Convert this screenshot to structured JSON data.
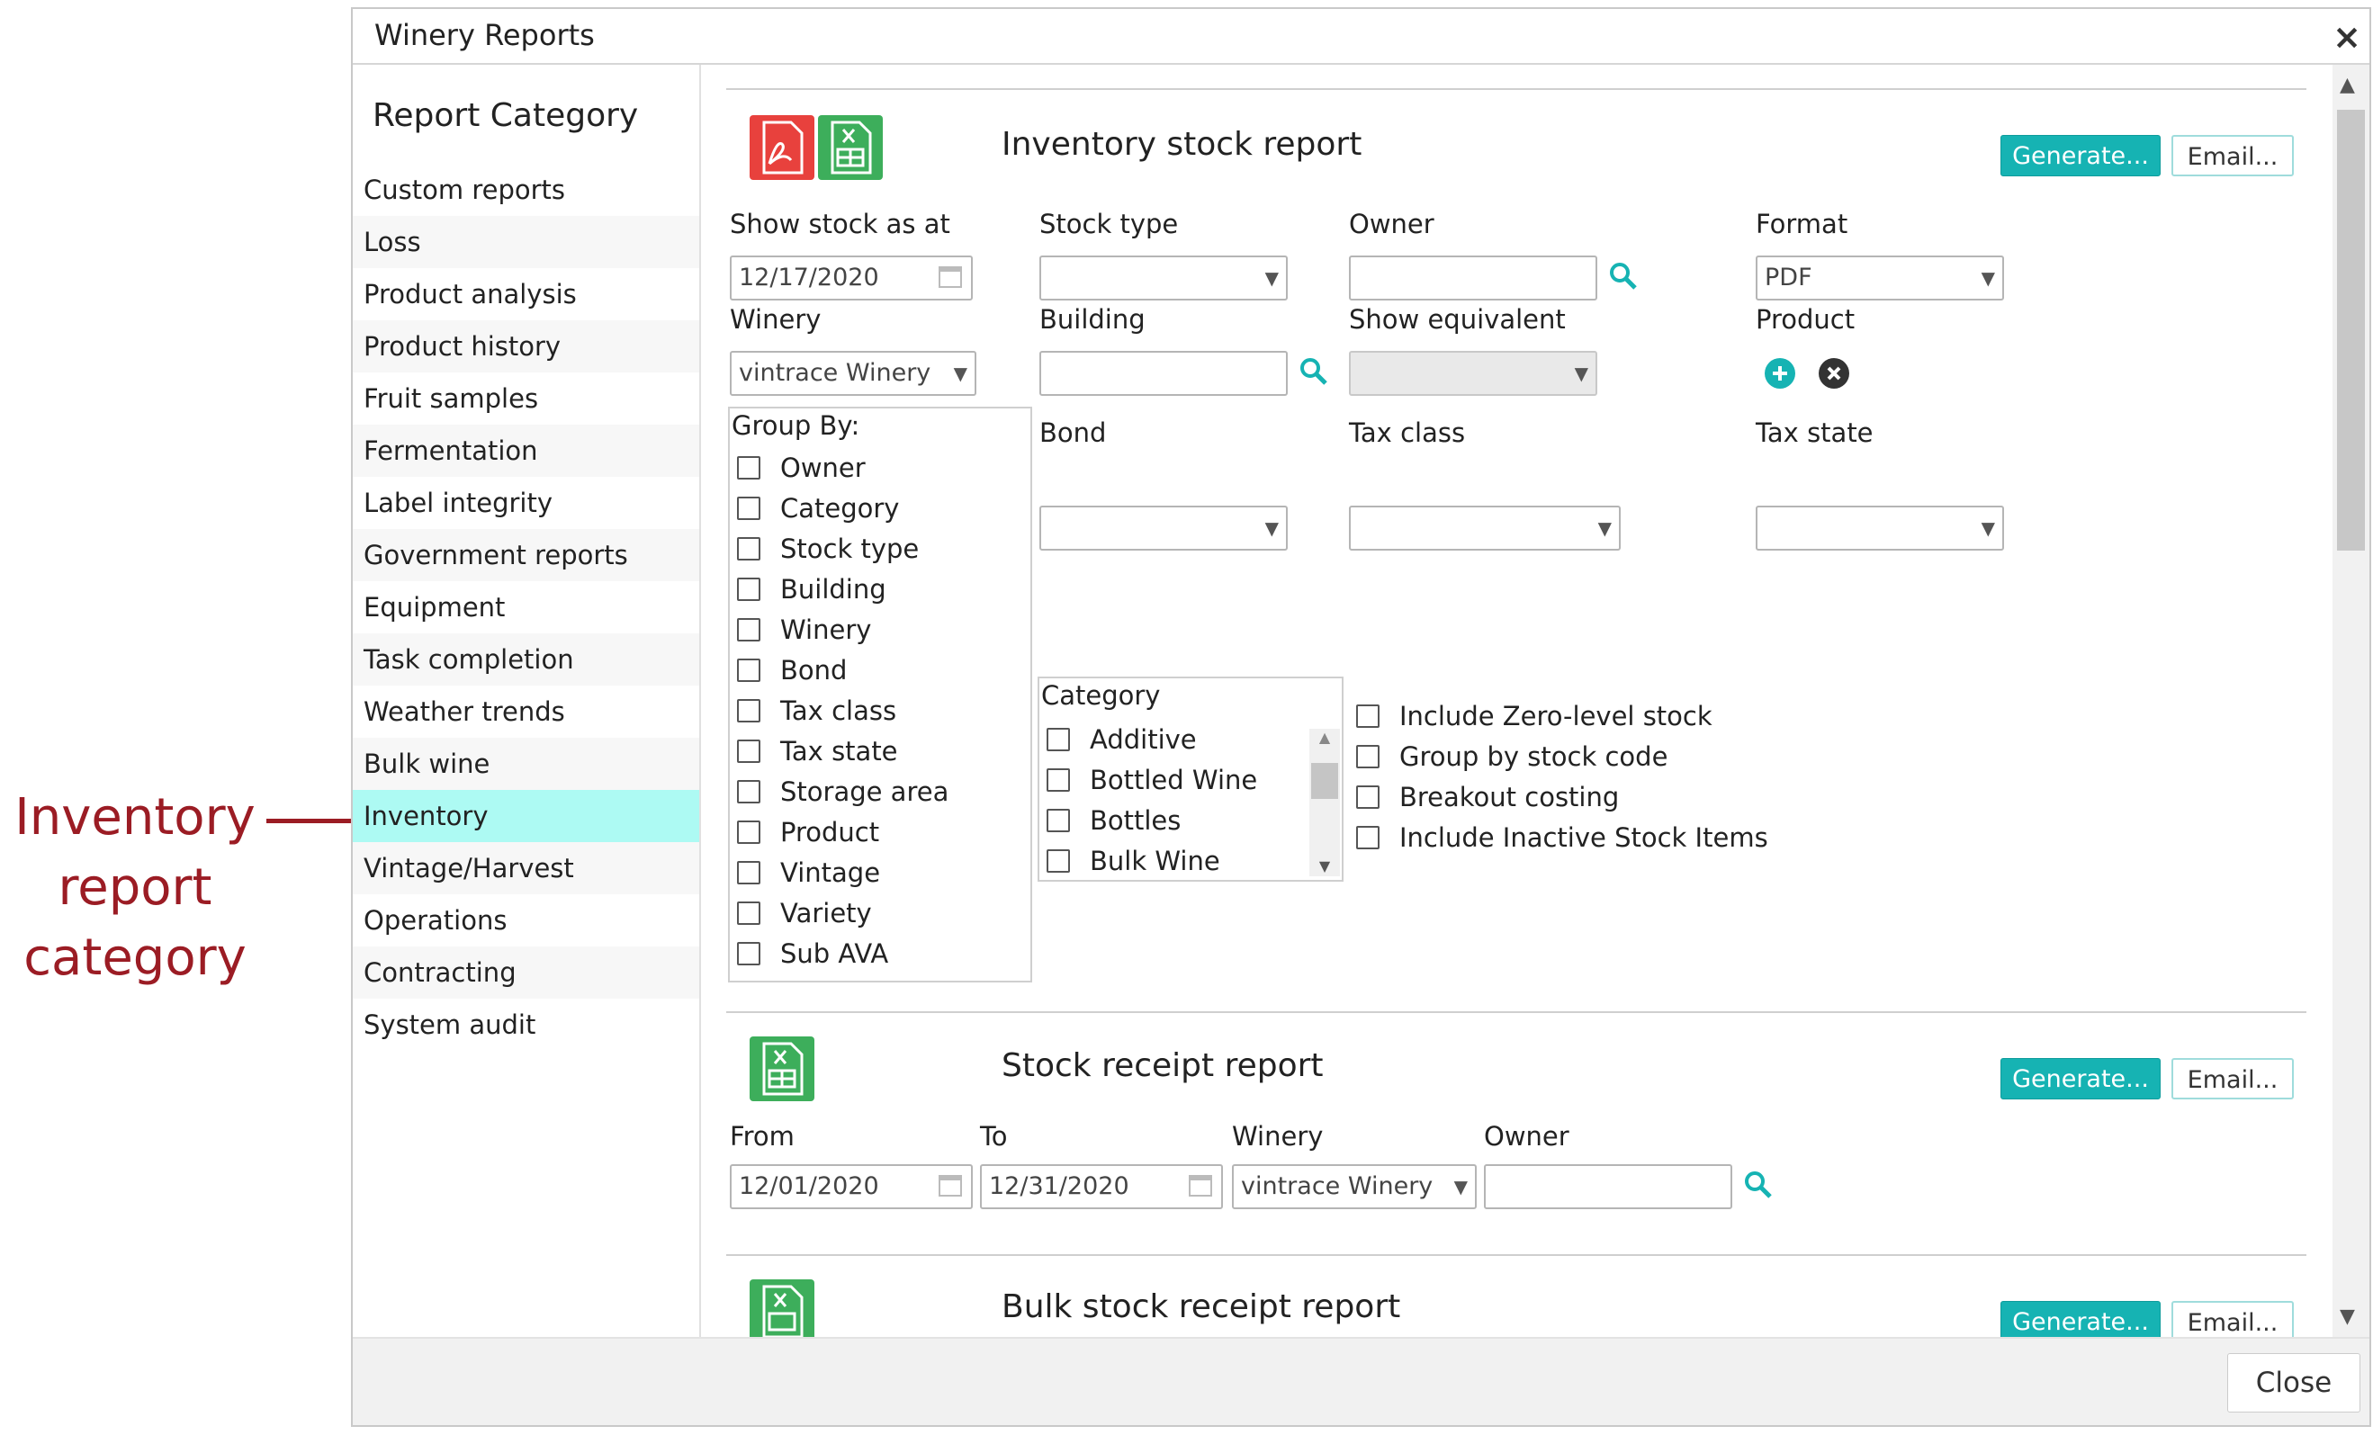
{
  "callout": {
    "line1": "Inventory",
    "line2": "report",
    "line3": "category"
  },
  "dialog": {
    "title": "Winery Reports",
    "close_icon": "×"
  },
  "sidebar": {
    "heading": "Report Category",
    "items": [
      {
        "label": "Custom reports"
      },
      {
        "label": "Loss"
      },
      {
        "label": "Product analysis"
      },
      {
        "label": "Product history"
      },
      {
        "label": "Fruit samples"
      },
      {
        "label": "Fermentation"
      },
      {
        "label": "Label integrity"
      },
      {
        "label": "Government reports"
      },
      {
        "label": "Equipment"
      },
      {
        "label": "Task completion"
      },
      {
        "label": "Weather trends"
      },
      {
        "label": "Bulk wine"
      },
      {
        "label": "Inventory"
      },
      {
        "label": "Vintage/Harvest"
      },
      {
        "label": "Operations"
      },
      {
        "label": "Contracting"
      },
      {
        "label": "System audit"
      }
    ]
  },
  "inventory": {
    "title": "Inventory stock report",
    "generate": "Generate...",
    "email": "Email...",
    "show_stock_as_at": {
      "label": "Show stock as at",
      "value": "12/17/2020"
    },
    "stock_type": {
      "label": "Stock type",
      "value": ""
    },
    "owner": {
      "label": "Owner",
      "value": ""
    },
    "format": {
      "label": "Format",
      "value": "PDF"
    },
    "winery": {
      "label": "Winery",
      "value": "vintrace Winery"
    },
    "building": {
      "label": "Building",
      "value": ""
    },
    "show_equivalent": {
      "label": "Show equivalent",
      "value": ""
    },
    "product": {
      "label": "Product"
    },
    "bond": {
      "label": "Bond",
      "value": ""
    },
    "tax_class": {
      "label": "Tax class",
      "value": ""
    },
    "tax_state": {
      "label": "Tax state",
      "value": ""
    },
    "group_by": {
      "title": "Group By:",
      "items": [
        "Owner",
        "Category",
        "Stock type",
        "Building",
        "Winery",
        "Bond",
        "Tax class",
        "Tax state",
        "Storage area",
        "Product",
        "Vintage",
        "Variety",
        "Sub AVA"
      ]
    },
    "category": {
      "title": "Category",
      "items": [
        "Additive",
        "Bottled Wine",
        "Bottles",
        "Bulk Wine"
      ]
    },
    "options": [
      "Include Zero-level stock",
      "Group by stock code",
      "Breakout costing",
      "Include Inactive Stock Items"
    ]
  },
  "receipt": {
    "title": "Stock receipt report",
    "generate": "Generate...",
    "email": "Email...",
    "from": {
      "label": "From",
      "value": "12/01/2020"
    },
    "to": {
      "label": "To",
      "value": "12/31/2020"
    },
    "winery": {
      "label": "Winery",
      "value": "vintrace Winery"
    },
    "owner": {
      "label": "Owner",
      "value": ""
    }
  },
  "bulk_receipt": {
    "title": "Bulk stock receipt report",
    "generate": "Generate...",
    "email": "Email..."
  },
  "footer": {
    "close": "Close"
  },
  "colors": {
    "accent": "#16b3b3",
    "active_row": "#adfaf3",
    "callout": "#9b1c24",
    "pdf": "#e8413d",
    "xls": "#3dae5b"
  }
}
